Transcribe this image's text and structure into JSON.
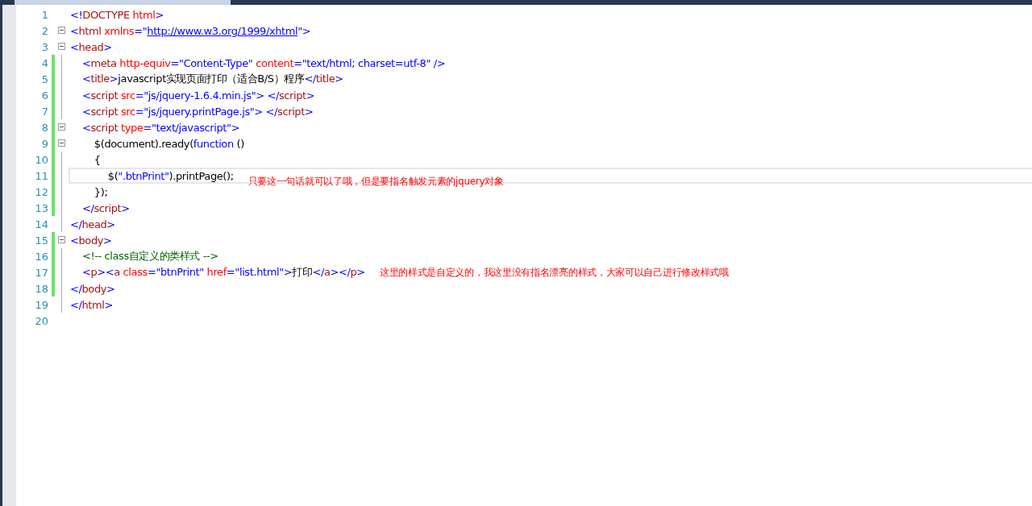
{
  "lines": [
    {
      "number": "1",
      "foldable": false,
      "changed": false,
      "current": false,
      "tokens": [
        {
          "text": "<!",
          "kind": "punct"
        },
        {
          "text": "DOCTYPE",
          "kind": "tag"
        },
        {
          "text": " html",
          "kind": "attr"
        },
        {
          "text": ">",
          "kind": "punct"
        }
      ]
    },
    {
      "number": "2",
      "foldable": true,
      "changed": false,
      "current": false,
      "tokens": [
        {
          "text": "<",
          "kind": "punct"
        },
        {
          "text": "html",
          "kind": "tag"
        },
        {
          "text": " xmlns",
          "kind": "attr"
        },
        {
          "text": "=\"",
          "kind": "punct"
        },
        {
          "text": "http://www.w3.org/1999/xhtml",
          "kind": "link"
        },
        {
          "text": "\">",
          "kind": "punct"
        }
      ]
    },
    {
      "number": "3",
      "foldable": true,
      "changed": false,
      "current": false,
      "tokens": [
        {
          "text": "<",
          "kind": "punct"
        },
        {
          "text": "head",
          "kind": "tag"
        },
        {
          "text": ">",
          "kind": "punct"
        }
      ]
    },
    {
      "number": "4",
      "foldable": false,
      "changed": true,
      "current": false,
      "tokens": [
        {
          "text": "    <",
          "kind": "punct"
        },
        {
          "text": "meta",
          "kind": "tag"
        },
        {
          "text": " http-equiv",
          "kind": "attr"
        },
        {
          "text": "=",
          "kind": "punct"
        },
        {
          "text": "\"Content-Type\"",
          "kind": "value"
        },
        {
          "text": " content",
          "kind": "attr"
        },
        {
          "text": "=",
          "kind": "punct"
        },
        {
          "text": "\"text/html; charset=utf-8\"",
          "kind": "value"
        },
        {
          "text": " />",
          "kind": "punct"
        }
      ]
    },
    {
      "number": "5",
      "foldable": false,
      "changed": true,
      "current": false,
      "tokens": [
        {
          "text": "    <",
          "kind": "punct"
        },
        {
          "text": "title",
          "kind": "tag"
        },
        {
          "text": ">",
          "kind": "punct"
        },
        {
          "text": "javascript实现页面打印（适合B/S）程序",
          "kind": "text"
        },
        {
          "text": "</",
          "kind": "punct"
        },
        {
          "text": "title",
          "kind": "tag"
        },
        {
          "text": ">",
          "kind": "punct"
        }
      ]
    },
    {
      "number": "6",
      "foldable": false,
      "changed": true,
      "current": false,
      "tokens": [
        {
          "text": "    <",
          "kind": "punct"
        },
        {
          "text": "script",
          "kind": "tag"
        },
        {
          "text": " src",
          "kind": "attr"
        },
        {
          "text": "=",
          "kind": "punct"
        },
        {
          "text": "\"js/jquery-1.6.4.min.js\"",
          "kind": "value"
        },
        {
          "text": "> </",
          "kind": "punct"
        },
        {
          "text": "script",
          "kind": "tag"
        },
        {
          "text": ">",
          "kind": "punct"
        }
      ]
    },
    {
      "number": "7",
      "foldable": false,
      "changed": true,
      "current": false,
      "tokens": [
        {
          "text": "    <",
          "kind": "punct"
        },
        {
          "text": "script",
          "kind": "tag"
        },
        {
          "text": " src",
          "kind": "attr"
        },
        {
          "text": "=",
          "kind": "punct"
        },
        {
          "text": "\"js/jquery.printPage.js\"",
          "kind": "value"
        },
        {
          "text": "> </",
          "kind": "punct"
        },
        {
          "text": "script",
          "kind": "tag"
        },
        {
          "text": ">",
          "kind": "punct"
        }
      ]
    },
    {
      "number": "8",
      "foldable": true,
      "changed": true,
      "current": false,
      "tokens": [
        {
          "text": "    <",
          "kind": "punct"
        },
        {
          "text": "script",
          "kind": "tag"
        },
        {
          "text": " type",
          "kind": "attr"
        },
        {
          "text": "=",
          "kind": "punct"
        },
        {
          "text": "\"text/javascript\"",
          "kind": "value"
        },
        {
          "text": ">",
          "kind": "punct"
        }
      ]
    },
    {
      "number": "9",
      "foldable": true,
      "changed": true,
      "current": false,
      "tokens": [
        {
          "text": "        $(document).ready(",
          "kind": "text"
        },
        {
          "text": "function",
          "kind": "keyword"
        },
        {
          "text": " ()",
          "kind": "text"
        }
      ]
    },
    {
      "number": "10",
      "foldable": false,
      "changed": true,
      "current": false,
      "tokens": [
        {
          "text": "        {",
          "kind": "text"
        }
      ]
    },
    {
      "number": "11",
      "foldable": false,
      "changed": true,
      "current": true,
      "tokens": [
        {
          "text": "            $(",
          "kind": "text"
        },
        {
          "text": "\".btnPrint\"",
          "kind": "value"
        },
        {
          "text": ").printPage();",
          "kind": "text"
        }
      ],
      "note": "只要这一句话就可以了哦，但是要指名触发元素的jquery对象"
    },
    {
      "number": "12",
      "foldable": false,
      "changed": true,
      "current": false,
      "tokens": [
        {
          "text": "        });",
          "kind": "text"
        }
      ]
    },
    {
      "number": "13",
      "foldable": false,
      "changed": true,
      "current": false,
      "tokens": [
        {
          "text": "    </",
          "kind": "punct"
        },
        {
          "text": "script",
          "kind": "tag"
        },
        {
          "text": ">",
          "kind": "punct"
        }
      ]
    },
    {
      "number": "14",
      "foldable": false,
      "changed": false,
      "current": false,
      "tokens": [
        {
          "text": "</",
          "kind": "punct"
        },
        {
          "text": "head",
          "kind": "tag"
        },
        {
          "text": ">",
          "kind": "punct"
        }
      ]
    },
    {
      "number": "15",
      "foldable": true,
      "changed": true,
      "current": false,
      "tokens": [
        {
          "text": "<",
          "kind": "punct"
        },
        {
          "text": "body",
          "kind": "tag"
        },
        {
          "text": ">",
          "kind": "punct"
        }
      ]
    },
    {
      "number": "16",
      "foldable": false,
      "changed": true,
      "current": false,
      "tokens": [
        {
          "text": "    <!-- class自定义的类样式 -->",
          "kind": "comment"
        }
      ]
    },
    {
      "number": "17",
      "foldable": false,
      "changed": true,
      "current": false,
      "tokens": [
        {
          "text": "    <",
          "kind": "punct"
        },
        {
          "text": "p",
          "kind": "tag"
        },
        {
          "text": "><",
          "kind": "punct"
        },
        {
          "text": "a",
          "kind": "tag"
        },
        {
          "text": " class",
          "kind": "attr"
        },
        {
          "text": "=",
          "kind": "punct"
        },
        {
          "text": "\"btnPrint\"",
          "kind": "value"
        },
        {
          "text": " href",
          "kind": "attr"
        },
        {
          "text": "=",
          "kind": "punct"
        },
        {
          "text": "\"list.html\"",
          "kind": "value"
        },
        {
          "text": ">",
          "kind": "punct"
        },
        {
          "text": "打印",
          "kind": "text"
        },
        {
          "text": "</",
          "kind": "punct"
        },
        {
          "text": "a",
          "kind": "tag"
        },
        {
          "text": "></",
          "kind": "punct"
        },
        {
          "text": "p",
          "kind": "tag"
        },
        {
          "text": ">",
          "kind": "punct"
        }
      ],
      "note": "这里的样式是自定义的，我这里没有指名漂亮的样式，大家可以自己进行修改样式哦"
    },
    {
      "number": "18",
      "foldable": false,
      "changed": true,
      "current": false,
      "tokens": [
        {
          "text": "</",
          "kind": "punct"
        },
        {
          "text": "body",
          "kind": "tag"
        },
        {
          "text": ">",
          "kind": "punct"
        }
      ]
    },
    {
      "number": "19",
      "foldable": false,
      "changed": false,
      "current": false,
      "tokens": [
        {
          "text": "</",
          "kind": "punct"
        },
        {
          "text": "html",
          "kind": "tag"
        },
        {
          "text": ">",
          "kind": "punct"
        }
      ]
    },
    {
      "number": "20",
      "foldable": false,
      "changed": false,
      "current": false
    }
  ]
}
